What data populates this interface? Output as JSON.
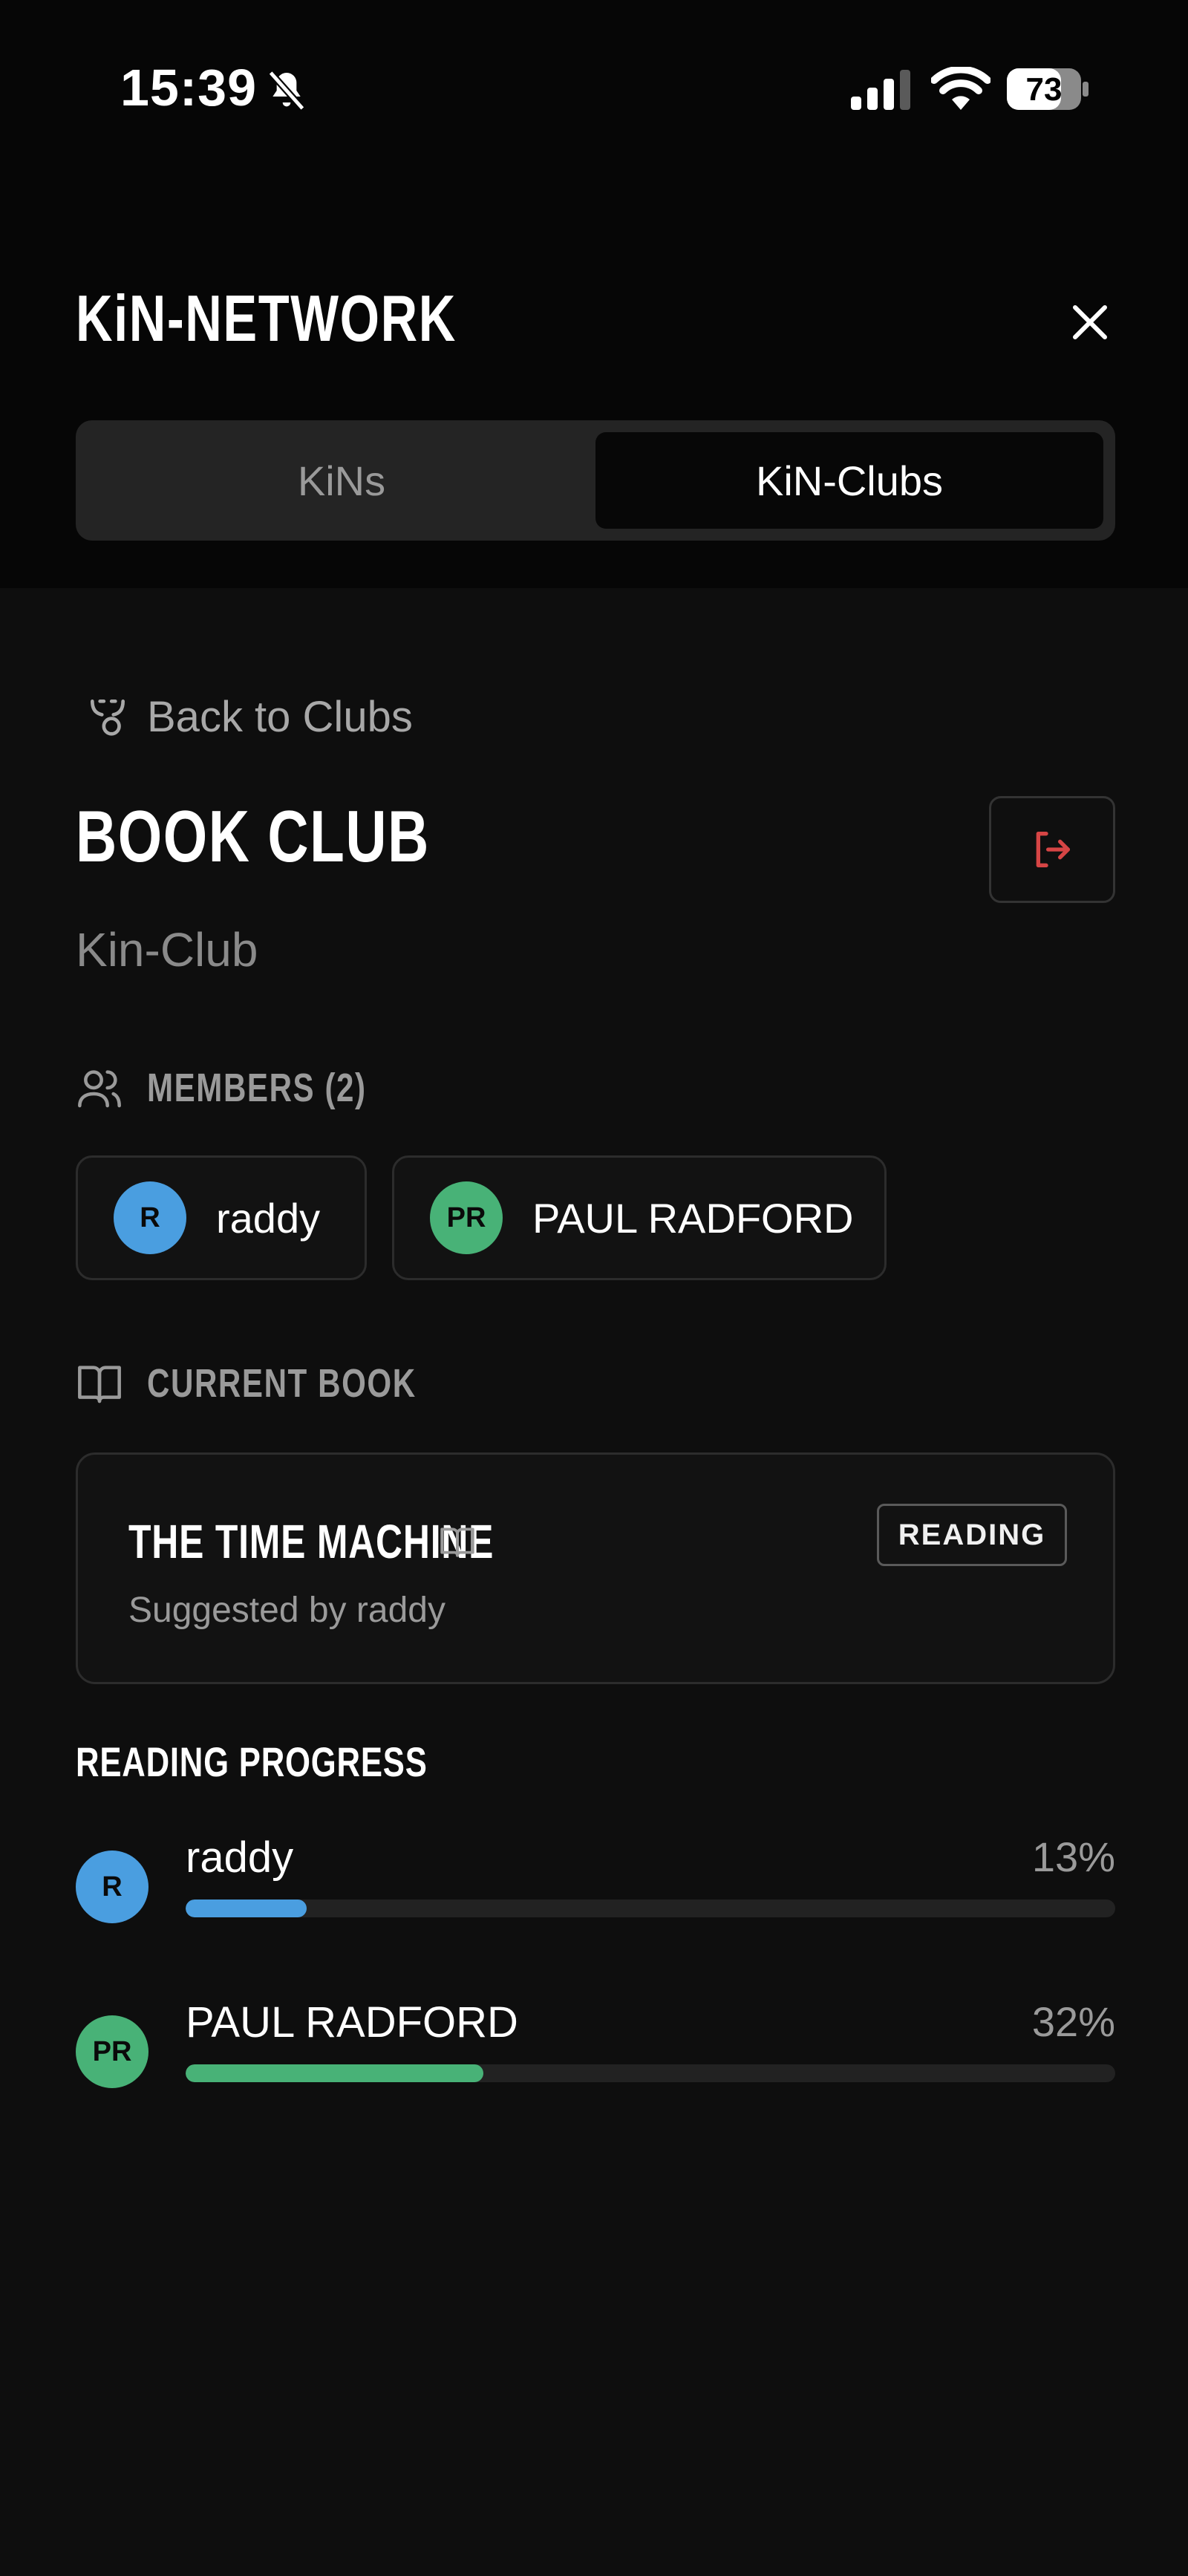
{
  "status_bar": {
    "time": "15:39",
    "battery": "73"
  },
  "header": {
    "title": "KiN-NETWORK",
    "tabs": [
      {
        "label": "KiNs",
        "selected": false
      },
      {
        "label": "KiN-Clubs",
        "selected": true
      }
    ]
  },
  "club": {
    "back_label": "Back to Clubs",
    "name": "BOOK CLUB",
    "type": "Kin-Club",
    "members_heading": "MEMBERS (2)",
    "members": [
      {
        "initials": "R",
        "name": "raddy",
        "color": "#4a9ee0"
      },
      {
        "initials": "PR",
        "name": "PAUL RADFORD",
        "color": "#48b277"
      }
    ],
    "current_book_heading": "CURRENT BOOK",
    "current_book": {
      "title": "THE TIME MACHINE",
      "suggested_by": "Suggested by raddy",
      "status": "READING"
    },
    "progress_heading": "READING PROGRESS",
    "progress": [
      {
        "initials": "R",
        "name": "raddy",
        "percent_label": "13%",
        "percent": 13,
        "color": "#4a9ee0"
      },
      {
        "initials": "PR",
        "name": "PAUL RADFORD",
        "percent_label": "32%",
        "percent": 32,
        "color": "#48b277"
      }
    ]
  },
  "icons": {
    "leave": "logout-icon",
    "members": "users-icon",
    "book": "book-open-icon",
    "back": "back-icon",
    "close": "close-icon"
  },
  "colors": {
    "accent_red": "#d64545",
    "blue": "#4a9ee0",
    "green": "#48b277"
  }
}
